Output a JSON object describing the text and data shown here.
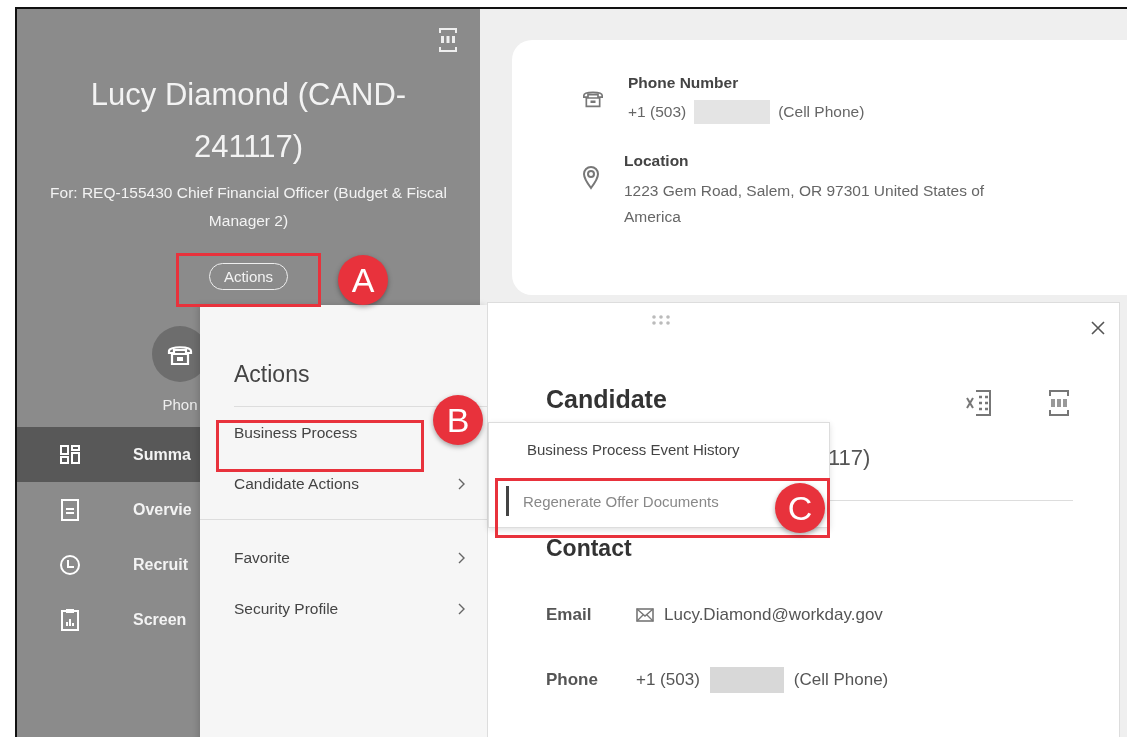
{
  "header": {
    "title": "Lucy Diamond (CAND-241117)",
    "subtitle": "For: REQ-155430 Chief Financial Officer (Budget & Fiscal Manager 2)",
    "actions_button": "Actions"
  },
  "quick_link": {
    "label": "Phon"
  },
  "nav": [
    {
      "label": "Summa",
      "selected": true
    },
    {
      "label": "Overvie",
      "selected": false
    },
    {
      "label": "Recruit",
      "selected": false
    },
    {
      "label": "Screen",
      "selected": false
    }
  ],
  "contact_card": [
    {
      "kind": "phone",
      "label": "Phone Number",
      "prefix": "+1 (503)",
      "suffix": "(Cell Phone)"
    },
    {
      "kind": "location",
      "label": "Location",
      "value": "1223 Gem Road, Salem, OR 97301 United States of America"
    }
  ],
  "actions_menu": {
    "title": "Actions",
    "groups": [
      [
        {
          "label": "Business Process"
        },
        {
          "label": "Candidate Actions",
          "chevron": true
        }
      ],
      [
        {
          "label": "Favorite",
          "chevron": true
        },
        {
          "label": "Security Profile",
          "chevron": true
        }
      ]
    ]
  },
  "submenu": [
    {
      "label": "Business Process Event History",
      "selected": false
    },
    {
      "label": "Regenerate Offer Documents",
      "selected": true
    }
  ],
  "popup": {
    "title": "Candidate",
    "subtitle_fragment": "117)",
    "section": "Contact",
    "rows": [
      {
        "kind": "email",
        "label": "Email",
        "value": "Lucy.Diamond@workday.gov"
      },
      {
        "kind": "phone",
        "label": "Phone",
        "prefix": "+1 (503)",
        "suffix": "(Cell Phone)"
      }
    ]
  },
  "annotations": [
    {
      "label": "A"
    },
    {
      "label": "B"
    },
    {
      "label": "C"
    }
  ]
}
